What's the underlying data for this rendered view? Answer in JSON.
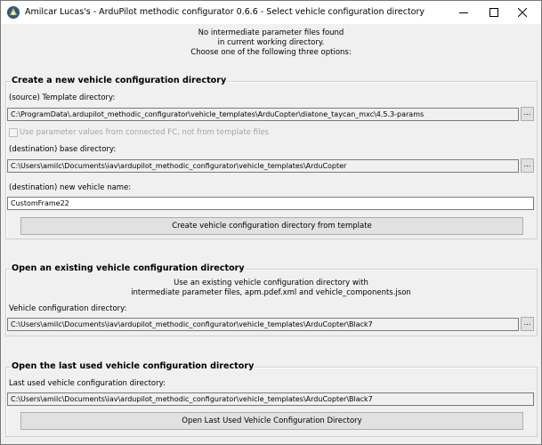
{
  "window": {
    "title": "Amilcar Lucas's - ArduPilot methodic configurator 0.6.6 - Select vehicle configuration directory",
    "controls": [
      "minimize",
      "maximize",
      "close"
    ]
  },
  "intro": {
    "line1": "No intermediate parameter files found",
    "line2": "in current working directory.",
    "line3": "Choose one of the following three options:"
  },
  "new_config": {
    "title": "Create a new vehicle configuration directory",
    "template_label": "(source) Template directory:",
    "template_value": "C:\\ProgramData\\.ardupilot_methodic_configurator\\vehicle_templates\\ArduCopter\\diatone_taycan_mxc\\4.5.3-params",
    "browse_label": "...",
    "checkbox_label": "Use parameter values from connected FC, not from template files",
    "base_label": "(destination) base directory:",
    "base_value": "C:\\Users\\amilc\\Documents\\iav\\ardupilot_methodic_configurator\\vehicle_templates\\ArduCopter",
    "name_label": "(destination) new vehicle name:",
    "name_value": "CustomFrame22",
    "create_button": "Create vehicle configuration directory from template"
  },
  "open_existing": {
    "title": "Open an existing vehicle configuration directory",
    "desc_line1": "Use an existing vehicle configuration directory with",
    "desc_line2": "intermediate parameter files, apm.pdef.xml and vehicle_components.json",
    "dir_label": "Vehicle configuration directory:",
    "dir_value": "C:\\Users\\amilc\\Documents\\iav\\ardupilot_methodic_configurator\\vehicle_templates\\ArduCopter\\Black7",
    "browse_label": "..."
  },
  "open_last": {
    "title": "Open the last used vehicle configuration directory",
    "dir_label": "Last used vehicle configuration directory:",
    "dir_value": "C:\\Users\\amilc\\Documents\\iav\\ardupilot_methodic_configurator\\vehicle_templates\\ArduCopter\\Black7",
    "open_button": "Open Last Used Vehicle Configuration Directory"
  },
  "icons": {
    "app": "ardupilot-app-icon",
    "minimize": "minimize-icon",
    "maximize": "maximize-icon",
    "close": "close-icon"
  }
}
